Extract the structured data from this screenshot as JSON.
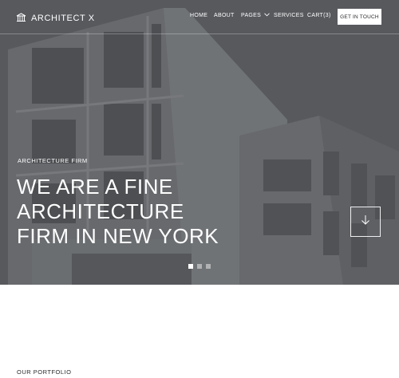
{
  "brand": {
    "name": "ARCHITECT X",
    "logo_icon": "building-columns-icon"
  },
  "nav": {
    "items": [
      "HOME",
      "ABOUT",
      "PAGES",
      "SERVICES",
      "CART(3)"
    ],
    "dropdown_icon": "chevron-down-icon",
    "cta": "GET IN TOUCH"
  },
  "hero": {
    "eyebrow": "ARCHITECTURE FIRM",
    "headline": [
      "WE ARE A FINE",
      "ARCHITECTURE",
      "FIRM IN NEW YORK"
    ],
    "scroll_icon": "arrow-down-icon",
    "slides": {
      "count": 3,
      "active": 1
    }
  },
  "portfolio": {
    "label": "OUR PORTFOLIO"
  },
  "colors": {
    "overlay": "#5f6266",
    "text_light": "#ffffff",
    "text_dark": "#2a2a2a"
  }
}
